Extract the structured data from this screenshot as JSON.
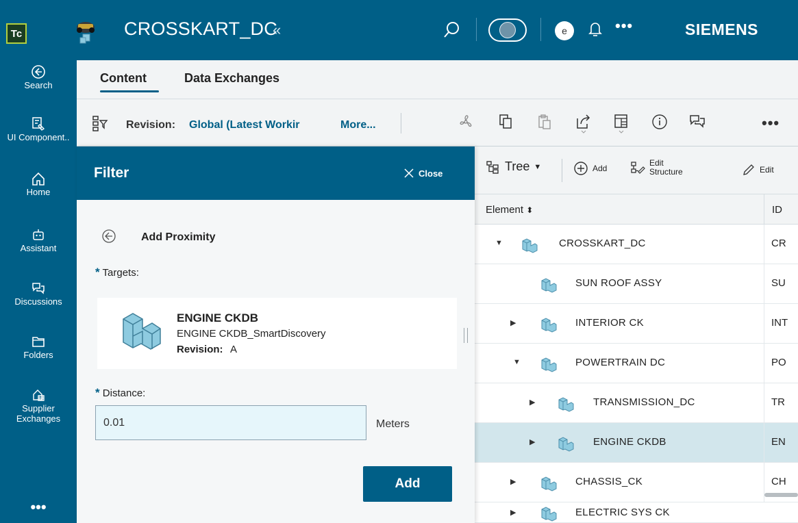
{
  "header": {
    "logo_text": "Tc",
    "title": "CROSSKART_DC",
    "collapse_glyph": "«",
    "avatar_initial": "e",
    "more_glyph": "•••",
    "brand": "SIEMENS"
  },
  "left_nav": {
    "items": [
      {
        "label": "Search",
        "icon": "search-back-icon"
      },
      {
        "label": "UI Component..",
        "icon": "ui-component-icon"
      },
      {
        "label": "Home",
        "icon": "home-icon"
      },
      {
        "label": "Assistant",
        "icon": "assistant-icon"
      },
      {
        "label": "Discussions",
        "icon": "discussions-icon"
      },
      {
        "label": "Folders",
        "icon": "folder-icon"
      },
      {
        "label": "Supplier Exchanges",
        "icon": "supplier-exchange-icon"
      }
    ],
    "more_glyph": "•••"
  },
  "tabs": [
    {
      "label": "Content",
      "active": true
    },
    {
      "label": "Data Exchanges",
      "active": false
    }
  ],
  "revision_bar": {
    "label": "Revision:",
    "value": "Global (Latest Workir",
    "more": "More...",
    "more_glyph": "•••"
  },
  "tree_toolbar": {
    "tree_label": "Tree",
    "add_label": "Add",
    "edit_structure_line1": "Edit",
    "edit_structure_line2": "Structure",
    "edit_label": "Edit"
  },
  "table": {
    "columns": [
      "Element",
      "ID"
    ],
    "rows": [
      {
        "name": "CROSSKART_DC",
        "id": "CR",
        "expanded": true
      },
      {
        "name": "SUN ROOF ASSY",
        "id": "SU",
        "expanded": null
      },
      {
        "name": "INTERIOR CK",
        "id": "INT",
        "expanded": false
      },
      {
        "name": "POWERTRAIN DC",
        "id": "PO",
        "expanded": true
      },
      {
        "name": "TRANSMISSION_DC",
        "id": "TR",
        "expanded": false
      },
      {
        "name": "ENGINE CKDB",
        "id": "EN",
        "expanded": false,
        "selected": true
      },
      {
        "name": "CHASSIS_CK",
        "id": "CH",
        "expanded": false
      },
      {
        "name": "ELECTRIC SYS CK",
        "id": "",
        "expanded": false
      }
    ]
  },
  "filter": {
    "title": "Filter",
    "close_label": "Close",
    "section_title": "Add Proximity",
    "required_mark": "*",
    "targets_label": "Targets:",
    "target": {
      "name": "ENGINE CKDB",
      "description": "ENGINE CKDB_SmartDiscovery",
      "revision_label": "Revision:",
      "revision_value": "A"
    },
    "distance_label": "Distance:",
    "distance_value": "0.01",
    "units": "Meters",
    "add_button": "Add"
  },
  "colors": {
    "brand_blue": "#005f87",
    "selected_row": "#d2e6ec",
    "input_bg": "#e6f6fb",
    "logo_green": "#b2cf3f"
  }
}
